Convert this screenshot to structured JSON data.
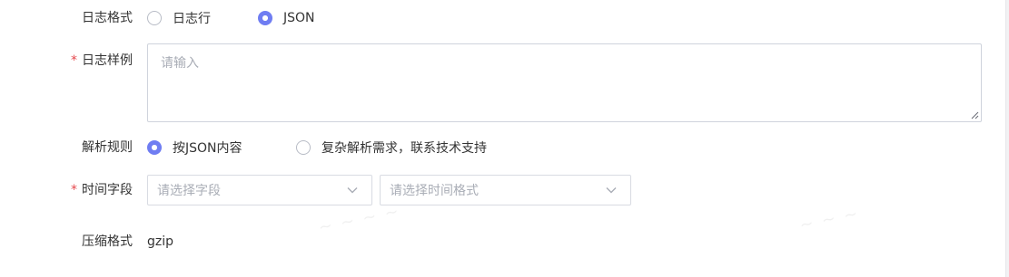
{
  "form": {
    "log_format": {
      "label": "日志格式",
      "options": [
        {
          "label": "日志行",
          "selected": false
        },
        {
          "label": "JSON",
          "selected": true
        }
      ]
    },
    "log_sample": {
      "label": "日志样例",
      "required": true,
      "value": "",
      "placeholder": "请输入"
    },
    "parse_rule": {
      "label": "解析规则",
      "options": [
        {
          "label": "按JSON内容",
          "selected": true
        },
        {
          "label": "复杂解析需求，联系技术支持",
          "selected": false
        }
      ]
    },
    "time_field": {
      "label": "时间字段",
      "required": true,
      "field_select": {
        "placeholder": "请选择字段",
        "icon": "chevron-down-icon"
      },
      "format_select": {
        "placeholder": "请选择时间格式",
        "icon": "chevron-down-icon"
      }
    },
    "compression": {
      "label": "压缩格式",
      "value": "gzip"
    }
  },
  "colors": {
    "accent": "#6f7df2",
    "required": "#e5484d",
    "border": "#cfd3dc",
    "placeholder": "#a9adb6",
    "text": "#333333"
  }
}
